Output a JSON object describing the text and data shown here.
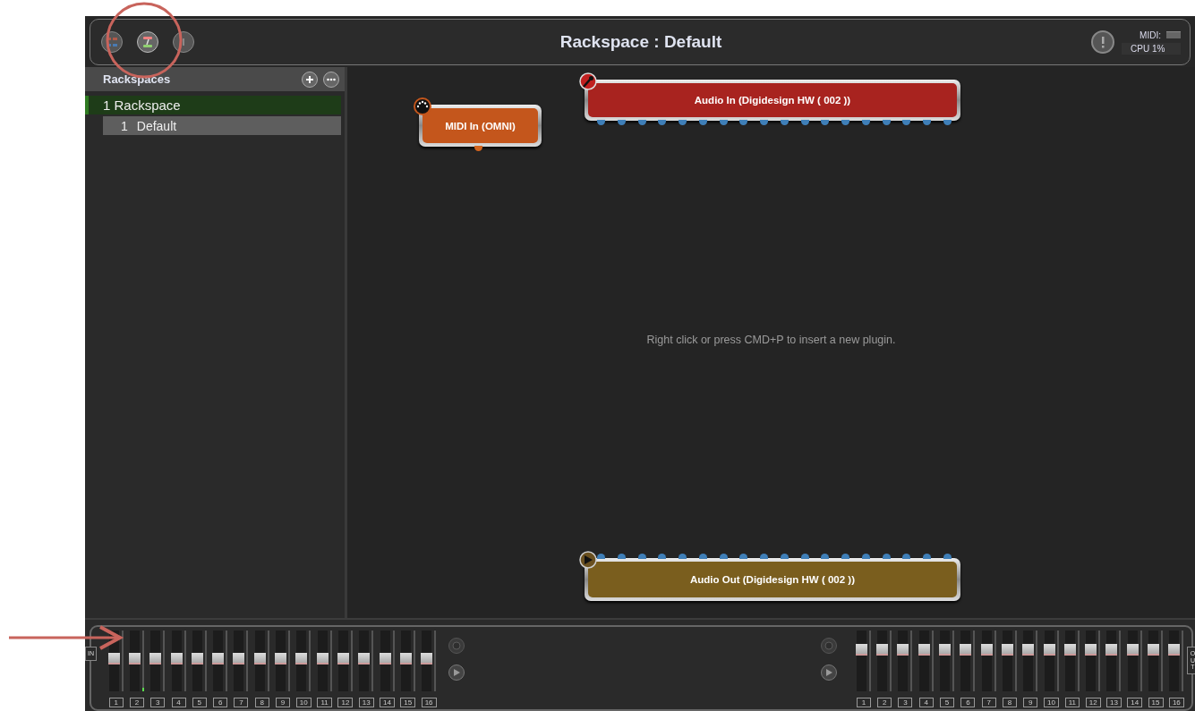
{
  "toolbar": {
    "title": "Rackspace : Default",
    "midi_label": "MIDI:",
    "cpu": "CPU 1%"
  },
  "sidebar": {
    "title": "Rackspaces",
    "items": [
      {
        "label": "1 Rackspace",
        "active": true,
        "selected": false,
        "children": [
          {
            "number": "1",
            "label": "Default",
            "active": false,
            "selected": true
          }
        ]
      }
    ]
  },
  "canvas": {
    "hint": "Right click or press CMD+P to insert a new plugin.",
    "nodes": [
      {
        "kind": "midi_in",
        "label": "MIDI In (OMNI)",
        "color": "#c4561c"
      },
      {
        "kind": "audio_in",
        "label": "Audio In (Digidesign HW ( 002 ))",
        "color": "#a8231f"
      },
      {
        "kind": "audio_out",
        "label": "Audio Out (Digidesign HW ( 002 ))",
        "color": "#7a5e1e"
      }
    ]
  },
  "mixer": {
    "input": {
      "label": "IN",
      "channels": [
        {
          "number": "1",
          "level": 0.53,
          "signal": false
        },
        {
          "number": "2",
          "level": 0.53,
          "signal": true
        },
        {
          "number": "3",
          "level": 0.53,
          "signal": false
        },
        {
          "number": "4",
          "level": 0.53,
          "signal": false
        },
        {
          "number": "5",
          "level": 0.53,
          "signal": false
        },
        {
          "number": "6",
          "level": 0.53,
          "signal": false
        },
        {
          "number": "7",
          "level": 0.53,
          "signal": false
        },
        {
          "number": "8",
          "level": 0.53,
          "signal": false
        },
        {
          "number": "9",
          "level": 0.53,
          "signal": false
        },
        {
          "number": "10",
          "level": 0.53,
          "signal": false
        },
        {
          "number": "11",
          "level": 0.53,
          "signal": false
        },
        {
          "number": "12",
          "level": 0.53,
          "signal": false
        },
        {
          "number": "13",
          "level": 0.53,
          "signal": false
        },
        {
          "number": "14",
          "level": 0.53,
          "signal": false
        },
        {
          "number": "15",
          "level": 0.53,
          "signal": false
        },
        {
          "number": "16",
          "level": 0.53,
          "signal": false
        }
      ]
    },
    "output": {
      "label": "OUT",
      "channels": [
        {
          "number": "1",
          "level": 0.68
        },
        {
          "number": "2",
          "level": 0.68
        },
        {
          "number": "3",
          "level": 0.68
        },
        {
          "number": "4",
          "level": 0.68
        },
        {
          "number": "5",
          "level": 0.68
        },
        {
          "number": "6",
          "level": 0.68
        },
        {
          "number": "7",
          "level": 0.68
        },
        {
          "number": "8",
          "level": 0.68
        },
        {
          "number": "9",
          "level": 0.68
        },
        {
          "number": "10",
          "level": 0.68
        },
        {
          "number": "11",
          "level": 0.68
        },
        {
          "number": "12",
          "level": 0.68
        },
        {
          "number": "13",
          "level": 0.68
        },
        {
          "number": "14",
          "level": 0.68
        },
        {
          "number": "15",
          "level": 0.68
        },
        {
          "number": "16",
          "level": 0.68
        }
      ]
    }
  }
}
